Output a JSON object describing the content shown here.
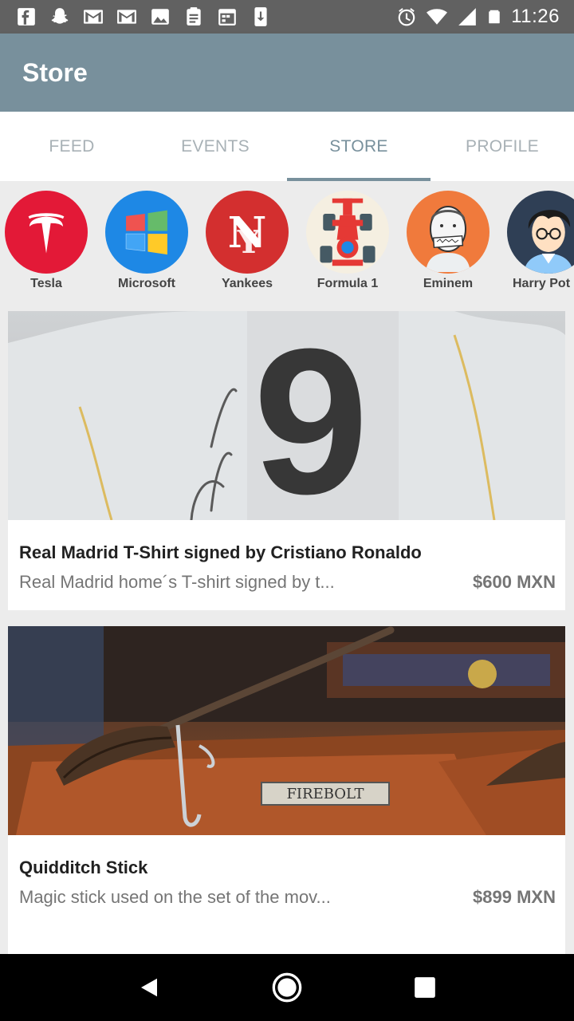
{
  "status_bar": {
    "time": "11:26",
    "left_icons": [
      "facebook-icon",
      "snapchat-icon",
      "gmail-icon",
      "gmail-icon",
      "gallery-icon",
      "clipboard-icon",
      "calendar-icon",
      "download-icon"
    ],
    "right_icons": [
      "alarm-icon",
      "wifi-icon",
      "signal-icon",
      "battery-icon"
    ]
  },
  "app_bar": {
    "title": "Store"
  },
  "tabs": [
    {
      "label": "FEED",
      "active": false
    },
    {
      "label": "EVENTS",
      "active": false
    },
    {
      "label": "STORE",
      "active": true
    },
    {
      "label": "PROFILE",
      "active": false
    }
  ],
  "brands": [
    {
      "label": "Tesla",
      "color": "#e31937"
    },
    {
      "label": "Microsoft",
      "color": "#1e88e5"
    },
    {
      "label": "Yankees",
      "color": "#d32f2f"
    },
    {
      "label": "Formula 1",
      "color": "#f5efe1"
    },
    {
      "label": "Eminem",
      "color": "#f07a3c"
    },
    {
      "label": "Harry Pot",
      "color": "#2f3f55"
    }
  ],
  "products": [
    {
      "title": "Real Madrid T-Shirt signed by Cristiano Ronaldo",
      "description": "Real Madrid home´s T-shirt signed by t...",
      "price": "$600 MXN",
      "image_number": "9"
    },
    {
      "title": "Quidditch Stick",
      "description": "Magic stick used on the set of the mov...",
      "price": "$899 MXN",
      "image_plaque": "FIREBOLT"
    }
  ],
  "colors": {
    "app_bar": "#78909c",
    "status_bar": "#616161",
    "accent": "#78909c",
    "nav_bar": "#000000"
  }
}
